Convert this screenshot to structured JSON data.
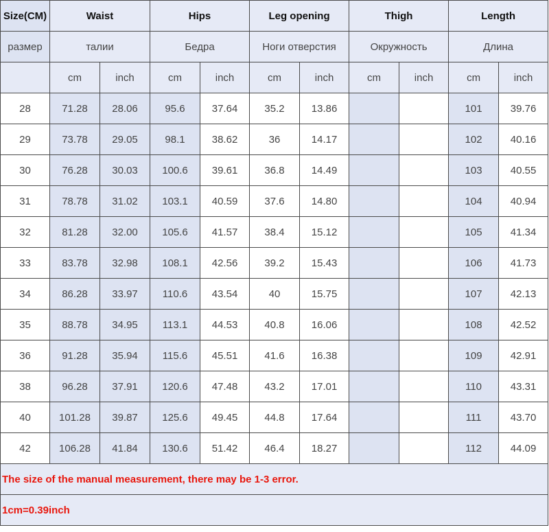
{
  "header": {
    "row1": [
      "Size(CM)",
      "Waist",
      "Hips",
      "Leg opening",
      "Thigh",
      "Length"
    ],
    "row2": [
      "размер",
      "талии",
      "Бедра",
      "Ноги отверстия",
      "Окружность",
      "Длина"
    ],
    "units": {
      "cm": "cm",
      "inch": "inch"
    }
  },
  "rows": [
    [
      "28",
      "71.28",
      "28.06",
      "95.6",
      "37.64",
      "35.2",
      "13.86",
      "",
      "",
      "101",
      "39.76"
    ],
    [
      "29",
      "73.78",
      "29.05",
      "98.1",
      "38.62",
      "36",
      "14.17",
      "",
      "",
      "102",
      "40.16"
    ],
    [
      "30",
      "76.28",
      "30.03",
      "100.6",
      "39.61",
      "36.8",
      "14.49",
      "",
      "",
      "103",
      "40.55"
    ],
    [
      "31",
      "78.78",
      "31.02",
      "103.1",
      "40.59",
      "37.6",
      "14.80",
      "",
      "",
      "104",
      "40.94"
    ],
    [
      "32",
      "81.28",
      "32.00",
      "105.6",
      "41.57",
      "38.4",
      "15.12",
      "",
      "",
      "105",
      "41.34"
    ],
    [
      "33",
      "83.78",
      "32.98",
      "108.1",
      "42.56",
      "39.2",
      "15.43",
      "",
      "",
      "106",
      "41.73"
    ],
    [
      "34",
      "86.28",
      "33.97",
      "110.6",
      "43.54",
      "40",
      "15.75",
      "",
      "",
      "107",
      "42.13"
    ],
    [
      "35",
      "88.78",
      "34.95",
      "113.1",
      "44.53",
      "40.8",
      "16.06",
      "",
      "",
      "108",
      "42.52"
    ],
    [
      "36",
      "91.28",
      "35.94",
      "115.6",
      "45.51",
      "41.6",
      "16.38",
      "",
      "",
      "109",
      "42.91"
    ],
    [
      "38",
      "96.28",
      "37.91",
      "120.6",
      "47.48",
      "43.2",
      "17.01",
      "",
      "",
      "110",
      "43.31"
    ],
    [
      "40",
      "101.28",
      "39.87",
      "125.6",
      "49.45",
      "44.8",
      "17.64",
      "",
      "",
      "111",
      "43.70"
    ],
    [
      "42",
      "106.28",
      "41.84",
      "130.6",
      "51.42",
      "46.4",
      "18.27",
      "",
      "",
      "112",
      "44.09"
    ]
  ],
  "notes": {
    "error": "The size of the manual measurement, there may be 1-3 error.",
    "conversion": "1cm=0.39inch"
  }
}
